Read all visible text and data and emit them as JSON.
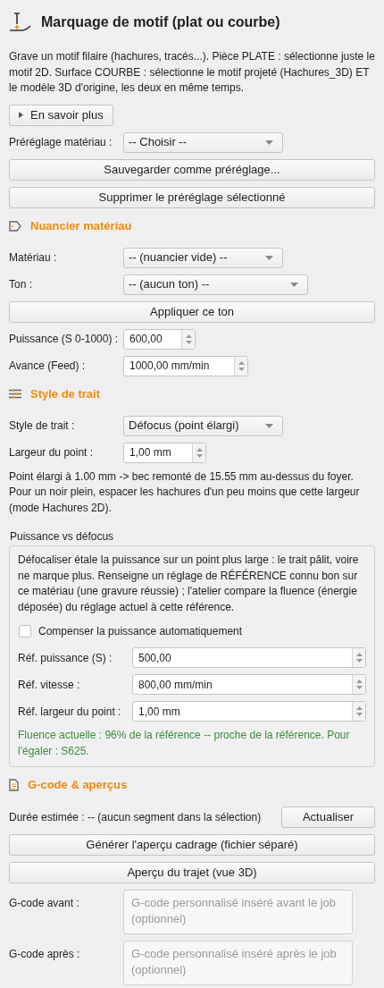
{
  "title": "Marquage de motif (plat ou courbe)",
  "items": [
    {
      "kind": "text",
      "text": "Grave un motif filaire (hachures, tracés...). Pièce PLATE : sélectionne juste le motif 2D. Surface COURBE : sélectionne le motif projeté (Hachures_3D) ET le modèle 3D d'origine, les deux en même temps."
    },
    {
      "kind": "toggle",
      "label": "En savoir plus",
      "expanded": false
    },
    {
      "kind": "combo",
      "label": "Préréglage matériau :",
      "value": "-- Choisir --"
    },
    {
      "kind": "button",
      "label": "Sauvegarder comme préréglage..."
    },
    {
      "kind": "button",
      "label": "Supprimer le préréglage sélectionné"
    },
    {
      "kind": "heading",
      "text": "Nuancier matériau"
    },
    {
      "kind": "combo",
      "label": "Matériau :",
      "value": "-- (nuancier vide) --"
    },
    {
      "kind": "combo",
      "label": "Ton :",
      "value": "-- (aucun ton) --"
    },
    {
      "kind": "button",
      "label": "Appliquer ce ton"
    },
    {
      "kind": "spin",
      "label": "Puissance (S 0-1000) :",
      "value": "600,00"
    },
    {
      "kind": "spin",
      "label": "Avance (Feed) :",
      "value": "1000,00 mm/min"
    },
    {
      "kind": "heading",
      "text": "Style de trait"
    },
    {
      "kind": "combo",
      "label": "Style de trait :",
      "value": "Défocus (point élargi)"
    },
    {
      "kind": "spin",
      "label": "Largeur du point :",
      "value": "1,00 mm"
    },
    {
      "kind": "text",
      "text": "Point élargi à 1.00 mm -> bec remonté de 15.55 mm au-dessus du foyer. Pour un noir plein, espacer les hachures d'un peu moins que cette largeur (mode Hachures 2D)."
    },
    {
      "kind": "group",
      "title": "Puissance vs défocus",
      "text": "Défocaliser étale la puissance sur un point plus large : le trait pâlit, voire ne marque plus. Renseigne un réglage de RÉFÉRENCE connu bon sur ce matériau (une gravure réussie) ; l'atelier compare la fluence (énergie déposée) du réglage actuel à cette référence.",
      "checkbox": {
        "label": "Compenser la puissance automatiquement",
        "checked": false
      },
      "fields": [
        {
          "label": "Réf. puissance (S) :",
          "value": "500,00"
        },
        {
          "label": "Réf. vitesse :",
          "value": "800,00 mm/min"
        },
        {
          "label": "Réf. largeur du point :",
          "value": "1,00 mm"
        }
      ],
      "status": "Fluence actuelle : 96% de la référence -- proche de la référence. Pour l'égaler : S625."
    },
    {
      "kind": "heading",
      "text": "G-code & aperçus"
    },
    {
      "kind": "estimate",
      "text": "Durée estimée : -- (aucun segment dans la sélection)",
      "button": "Actualiser"
    },
    {
      "kind": "button",
      "label": "Générer l'aperçu cadrage (fichier séparé)"
    },
    {
      "kind": "button",
      "label": "Aperçu du trajet (vue 3D)"
    },
    {
      "kind": "textarea",
      "label": "G-code avant :",
      "placeholder": "G-code personnalisé inséré avant le job (optionnel)"
    },
    {
      "kind": "textarea",
      "label": "G-code après :",
      "placeholder": "G-code personnalisé inséré après le job (optionnel)"
    }
  ]
}
